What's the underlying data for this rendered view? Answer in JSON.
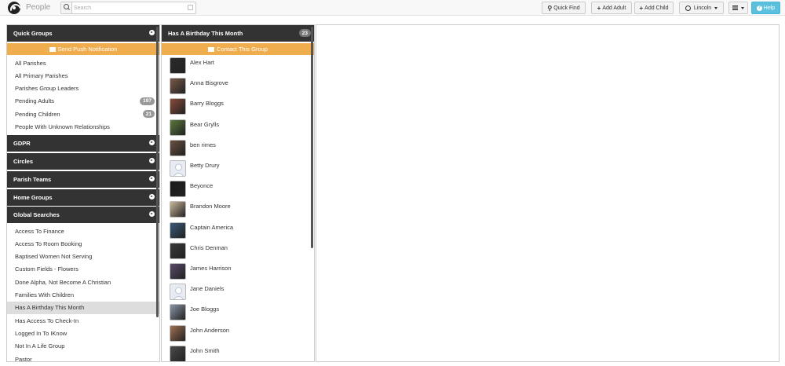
{
  "app": {
    "title": "People"
  },
  "search": {
    "placeholder": "Search",
    "value": ""
  },
  "toolbar": {
    "quick_find": "Quick Find",
    "add_adult": "Add Adult",
    "add_child": "Add Child",
    "site": "Lincoln",
    "help": "Help"
  },
  "left": {
    "quick_groups": {
      "title": "Quick Groups",
      "push_label": "Send Push Notification",
      "items": [
        {
          "label": "All Parishes",
          "badge": ""
        },
        {
          "label": "All Primary Parishes",
          "badge": ""
        },
        {
          "label": "Parishes Group Leaders",
          "badge": ""
        },
        {
          "label": "Pending Adults",
          "badge": "197"
        },
        {
          "label": "Pending Children",
          "badge": "21"
        },
        {
          "label": "People With Unknown Relationships",
          "badge": ""
        }
      ]
    },
    "sections": [
      "GDPR",
      "Circles",
      "Parish Teams",
      "Home Groups"
    ],
    "global_searches": {
      "title": "Global Searches",
      "selected_index": 6,
      "items": [
        "Access To Finance",
        "Access To Room Booking",
        "Baptised Women Not Serving",
        "Custom Fields - Flowers",
        "Done Alpha, Not Become A Christian",
        "Families With Children",
        "Has A Birthday This Month",
        "Has Access To Check-In",
        "Logged In To IKnow",
        "Not In A Life Group",
        "Pastor"
      ]
    }
  },
  "middle": {
    "title": "Has A Birthday This Month",
    "count": "23",
    "contact_label": "Contact This Group",
    "people": [
      {
        "name": "Alex Hart",
        "avatar": "#2a2a2a"
      },
      {
        "name": "Anna Bisgrove",
        "avatar": "#7a5a48"
      },
      {
        "name": "Barry Bloggs",
        "avatar": "#8a4a3a"
      },
      {
        "name": "Bear Grylls",
        "avatar": "#5a7a3a"
      },
      {
        "name": "ben rimes",
        "avatar": "#6a5040"
      },
      {
        "name": "Betty Drury",
        "avatar": "placeholder"
      },
      {
        "name": "Beyonce",
        "avatar": "#1a1a1a"
      },
      {
        "name": "Brandon Moore",
        "avatar": "#c9b89a"
      },
      {
        "name": "Captain America",
        "avatar": "#3a5a7a"
      },
      {
        "name": "Chris Denman",
        "avatar": "#3a3a3a"
      },
      {
        "name": "James Harrison",
        "avatar": "#5a4a6a"
      },
      {
        "name": "Jane Daniels",
        "avatar": "placeholder"
      },
      {
        "name": "Joe Bloggs",
        "avatar": "#8a95a5"
      },
      {
        "name": "John Anderson",
        "avatar": "#a07050"
      },
      {
        "name": "John Smith",
        "avatar": "#4a4a4a"
      }
    ]
  },
  "colors": {
    "header": "#333333",
    "accent": "#f0ad4e",
    "help": "#5bc0de"
  }
}
